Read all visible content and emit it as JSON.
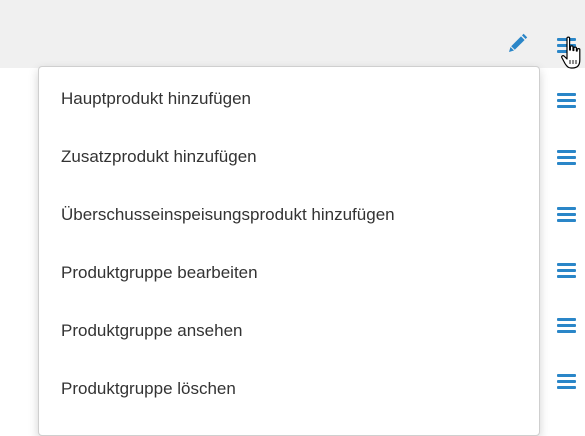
{
  "toolbar": {
    "edit_icon": "pencil-icon",
    "menu_icon": "hamburger-menu-icon"
  },
  "menu": {
    "items": [
      {
        "label": "Hauptprodukt hinzufügen"
      },
      {
        "label": "Zusatzprodukt hinzufügen"
      },
      {
        "label": "Überschusseinspeisungsprodukt hinzufügen"
      },
      {
        "label": "Produktgruppe bearbeiten"
      },
      {
        "label": "Produktgruppe ansehen"
      },
      {
        "label": "Produktgruppe löschen"
      }
    ]
  },
  "row_menu_icon": "hamburger-menu-icon",
  "colors": {
    "accent": "#2a86c8",
    "header_background": "#f0f0f0",
    "menu_text": "#333333"
  }
}
